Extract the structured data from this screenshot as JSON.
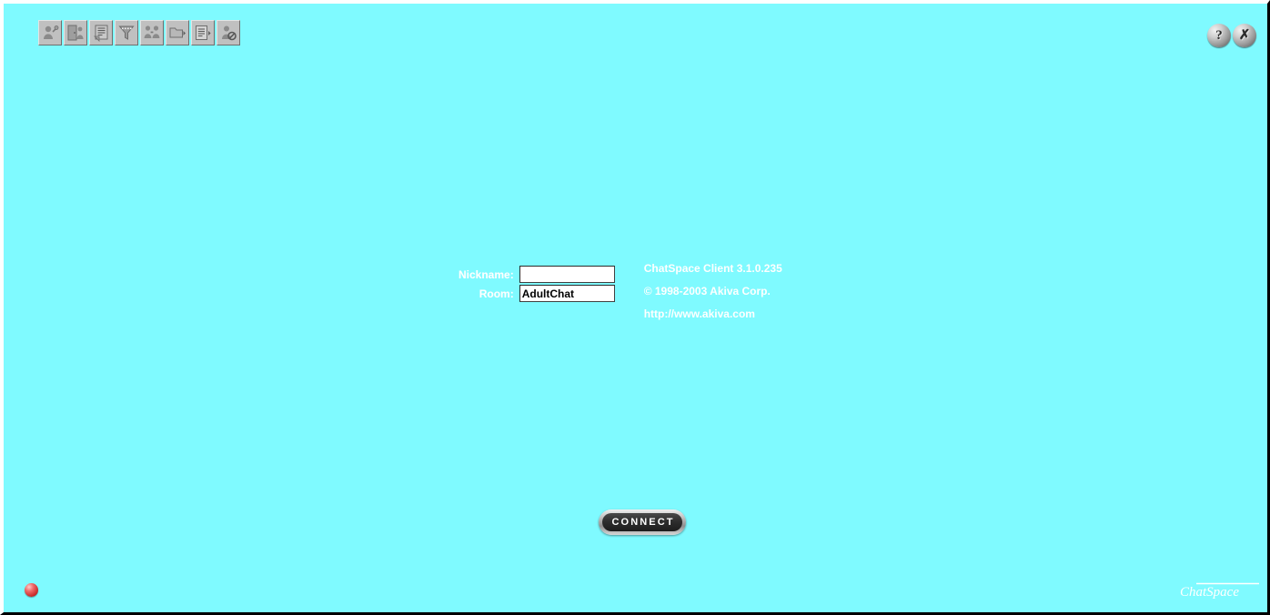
{
  "window": {
    "title": "ChatSpace Client",
    "background_color": "#7ffaff",
    "border_color_light": "#ffffff",
    "border_color_dark": "#000000"
  },
  "toolbar": {
    "buttons": [
      {
        "name": "user-profile-icon",
        "tooltip": "Profile"
      },
      {
        "name": "exit-door-icon",
        "tooltip": "Exit Room"
      },
      {
        "name": "message-list-icon",
        "tooltip": "Messages"
      },
      {
        "name": "filter-funnel-icon",
        "tooltip": "Filter"
      },
      {
        "name": "people-group-icon",
        "tooltip": "Members"
      },
      {
        "name": "folder-dropdown-icon",
        "tooltip": "Rooms"
      },
      {
        "name": "notepad-dropdown-icon",
        "tooltip": "Logs"
      },
      {
        "name": "ignore-user-icon",
        "tooltip": "Ignore"
      }
    ]
  },
  "topright": {
    "buttons": [
      {
        "name": "help-button",
        "glyph": "?",
        "tooltip": "Help"
      },
      {
        "name": "tools-button",
        "glyph": "✗",
        "tooltip": "Tools"
      }
    ]
  },
  "login": {
    "nickname_label": "Nickname:",
    "nickname_value": "",
    "nickname_placeholder": "",
    "room_label": "Room:",
    "room_value": "AdultChat",
    "room_placeholder": ""
  },
  "about": {
    "version_line": "ChatSpace Client 3.1.0.235",
    "copyright_line": "© 1998-2003 Akiva Corp.",
    "url_line": "http://www.akiva.com",
    "text_color": "#ffffff"
  },
  "connect": {
    "label": "CONNECT"
  },
  "status": {
    "led_name": "disconnected-status-led",
    "led_color": "#cc2f2f"
  },
  "brand": {
    "logo_text": "ChatSpace"
  }
}
